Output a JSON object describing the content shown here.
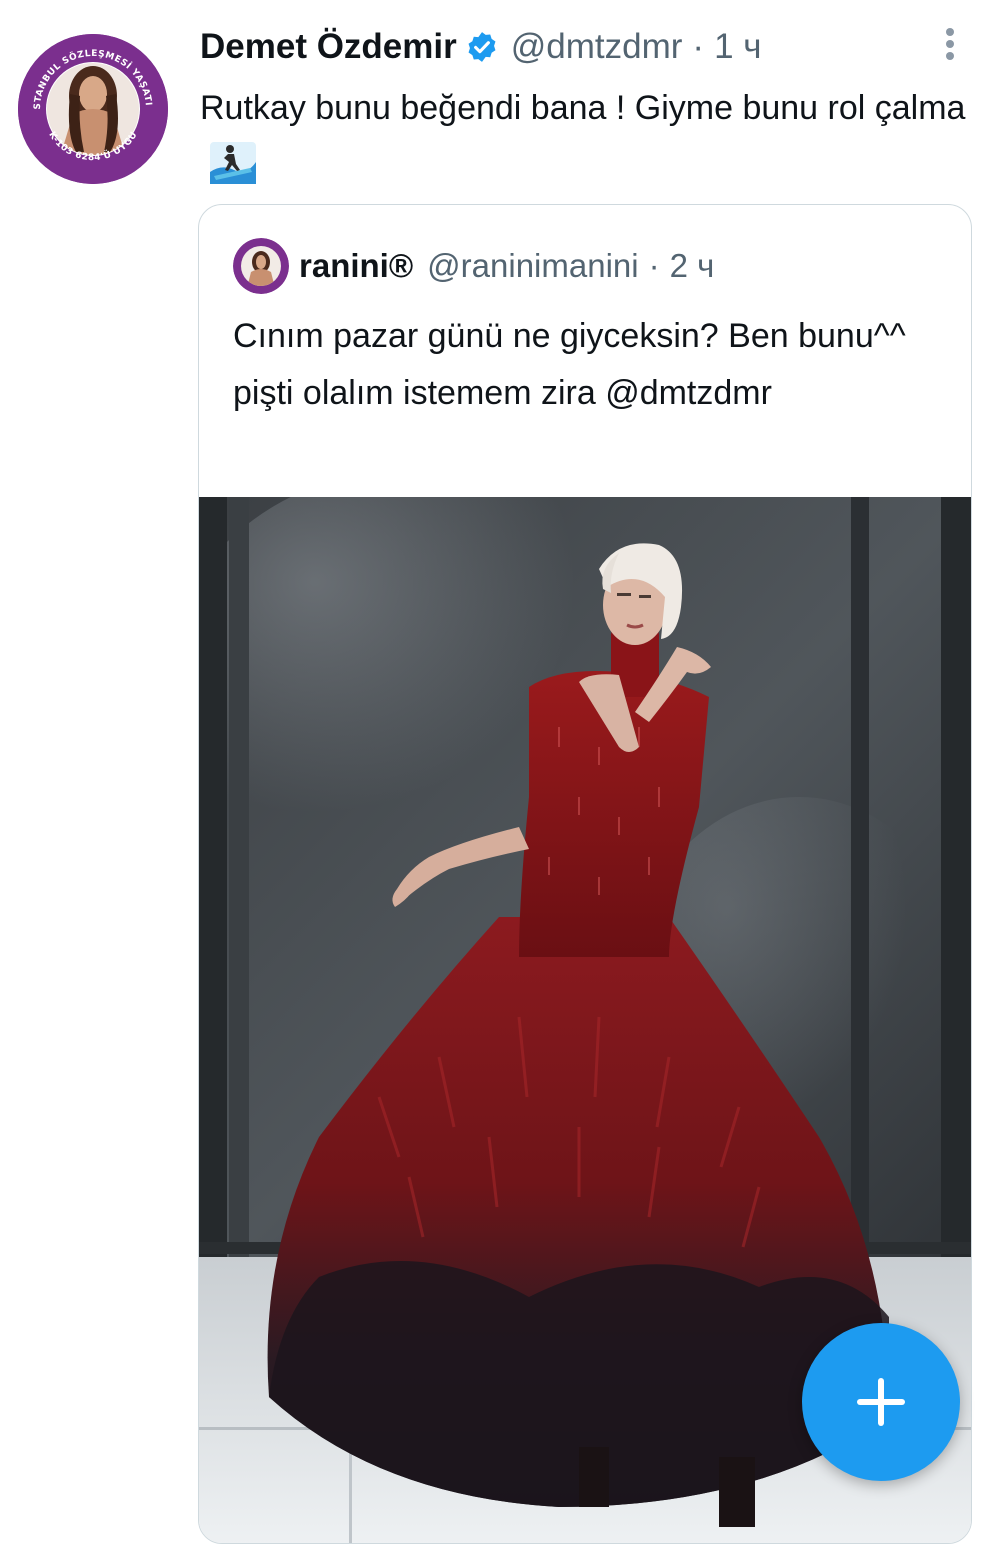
{
  "tweet": {
    "author_name": "Demet Özdemir",
    "handle": "@dmtzdmr",
    "separator": "·",
    "time": "1 ч",
    "text": "Rutkay bunu beğendi bana ! Giyme bunu rol çalma",
    "text_icon": "person-surfing-icon",
    "avatar_ring_text_top": "İSTANBUL SÖZLEŞMESİ YAŞATIR",
    "avatar_ring_text_bottom": "TCK-103 6284'Ü UYGULA"
  },
  "quoted_tweet": {
    "author_name": "ranini®",
    "handle": "@raninimanini",
    "separator": "·",
    "time": "2 ч",
    "text": "Cınım pazar günü ne giyceksin? Ben bunu^^ pişti olalım istemem zira @dmtzdmr",
    "media": "photo-woman-red-feather-gown"
  },
  "fab": {
    "icon": "plus-icon",
    "color": "#1d9bf0"
  },
  "colors": {
    "verified_badge": "#1d9bf0",
    "secondary_text": "#536471",
    "avatar_ring": "#7b2f8e"
  }
}
